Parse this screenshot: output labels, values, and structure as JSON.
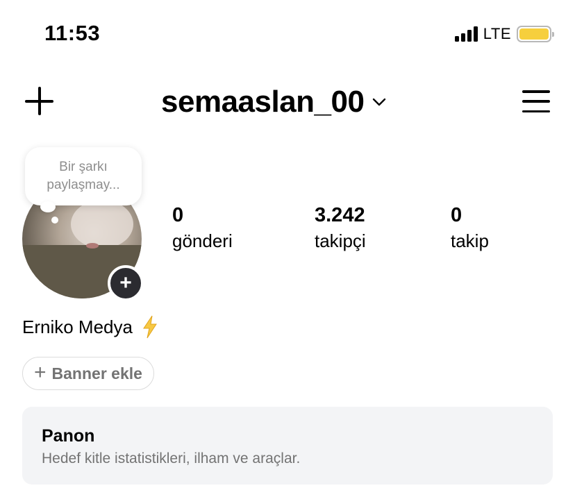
{
  "status_bar": {
    "time": "11:53",
    "network": "LTE",
    "battery_color": "#f6cf3d"
  },
  "header": {
    "username": "semaaslan_00",
    "add_icon": "plus-icon",
    "menu_icon": "hamburger-icon",
    "switch_icon": "chevron-down-icon"
  },
  "note": {
    "text_line1": "Bir şarkı",
    "text_line2": "paylaşmay..."
  },
  "profile": {
    "add_story_symbol": "+",
    "display_name": "Erniko Medya",
    "badge_icon": "lightning-icon"
  },
  "stats": [
    {
      "value": "0",
      "label": "gönderi"
    },
    {
      "value": "3.242",
      "label": "takipçi"
    },
    {
      "value": "0",
      "label": "takip"
    }
  ],
  "banner": {
    "label": "Banner ekle",
    "icon": "plus-icon"
  },
  "dashboard": {
    "title": "Panon",
    "subtitle": "Hedef kitle istatistikleri, ilham ve araçlar."
  }
}
